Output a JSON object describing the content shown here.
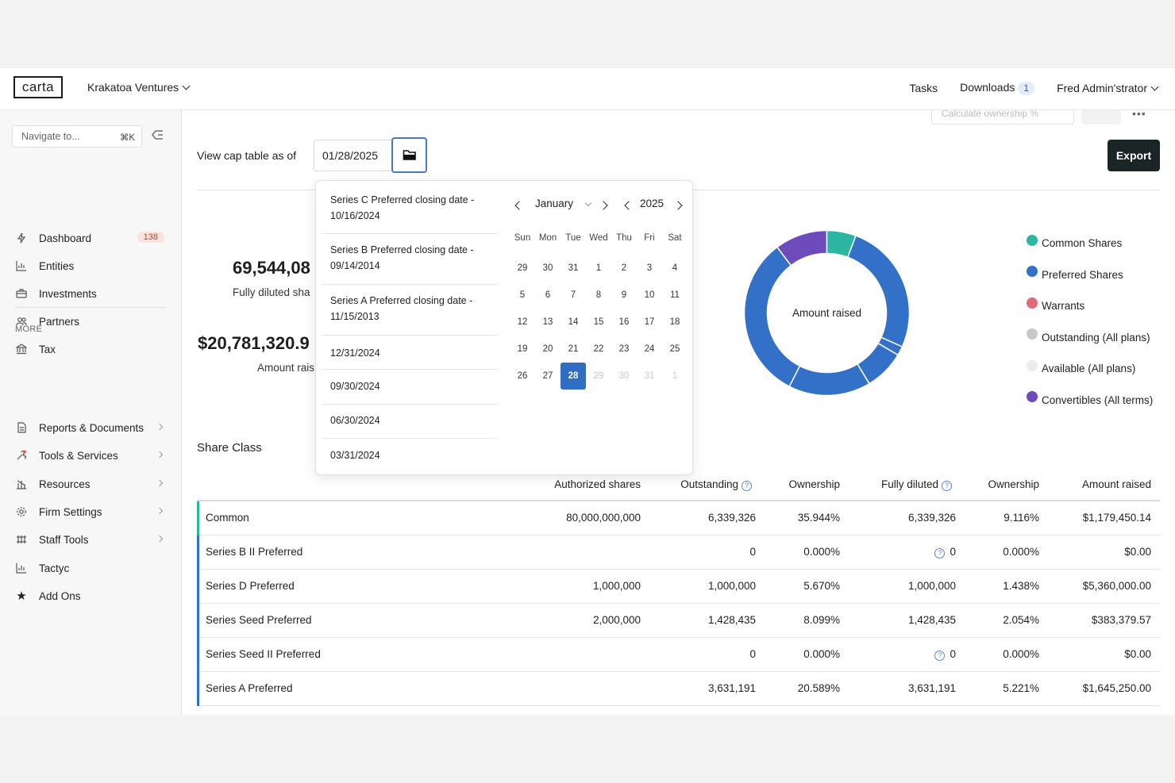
{
  "app": {
    "logo": "carta",
    "org_name": "Krakatoa Ventures",
    "tasks_label": "Tasks",
    "downloads_label": "Downloads",
    "downloads_count": "1",
    "user_name": "Fred Admin'strator"
  },
  "sidebar": {
    "search_placeholder": "Navigate to...",
    "search_shortcut": "⌘K",
    "items": [
      {
        "label": "Dashboard",
        "icon": "bolt-icon",
        "badge": "138"
      },
      {
        "label": "Entities",
        "icon": "chart-icon"
      },
      {
        "label": "Investments",
        "icon": "briefcase-icon"
      },
      {
        "label": "Partners",
        "icon": "people-icon"
      },
      {
        "label": "Tax",
        "icon": "bank-icon"
      }
    ],
    "more_label": "MORE",
    "more_items": [
      {
        "label": "Reports & Documents",
        "icon": "document-icon"
      },
      {
        "label": "Tools & Services",
        "icon": "tools-icon"
      },
      {
        "label": "Resources",
        "icon": "resources-icon"
      },
      {
        "label": "Firm Settings",
        "icon": "gear-icon"
      },
      {
        "label": "Staff Tools",
        "icon": "staff-icon"
      },
      {
        "label": "Tactyc",
        "icon": "chart-icon"
      },
      {
        "label": "Add Ons",
        "icon": "star-icon"
      }
    ]
  },
  "main": {
    "ghost_button": "Calculate ownership %",
    "view_as_of_label": "View cap table as of",
    "date_value": "01/28/2025",
    "export_label": "Export",
    "stats": {
      "fully_diluted_value": "69,544,08",
      "fully_diluted_label": "Fully diluted sha",
      "amount_raised_value": "$20,781,320.9",
      "amount_raised_label": "Amount rais"
    },
    "donut_center_label": "Amount raised",
    "legend": [
      {
        "label": "Common Shares",
        "color": "#2cb5a0"
      },
      {
        "label": "Preferred Shares",
        "color": "#3370c7"
      },
      {
        "label": "Warrants",
        "color": "#e06a7a"
      },
      {
        "label": "Outstanding (All plans)",
        "color": "#c8c8c8"
      },
      {
        "label": "Available (All plans)",
        "color": "#ececec"
      },
      {
        "label": "Convertibles (All terms)",
        "color": "#6d4bbd"
      }
    ],
    "share_class_title": "Share Class",
    "table": {
      "headers": [
        "Authorized shares",
        "Outstanding",
        "Ownership",
        "Fully diluted",
        "Ownership",
        "Amount raised"
      ],
      "rows": [
        {
          "name": "Common",
          "authorized": "80,000,000,000",
          "outstanding": "6,339,326",
          "ownership": "35.944%",
          "fully_diluted": "6,339,326",
          "fd_ownership": "9.116%",
          "amount": "$1,179,450.14",
          "color": "#2cb5a0",
          "fd_help": false
        },
        {
          "name": "Series B II Preferred",
          "authorized": "",
          "outstanding": "0",
          "ownership": "0.000%",
          "fully_diluted": "0",
          "fd_ownership": "0.000%",
          "amount": "$0.00",
          "color": "#3370c7",
          "fd_help": true
        },
        {
          "name": "Series D Preferred",
          "authorized": "1,000,000",
          "outstanding": "1,000,000",
          "ownership": "5.670%",
          "fully_diluted": "1,000,000",
          "fd_ownership": "1.438%",
          "amount": "$5,360,000.00",
          "color": "#3370c7",
          "fd_help": false
        },
        {
          "name": "Series Seed Preferred",
          "authorized": "2,000,000",
          "outstanding": "1,428,435",
          "ownership": "8.099%",
          "fully_diluted": "1,428,435",
          "fd_ownership": "2.054%",
          "amount": "$383,379.57",
          "color": "#3370c7",
          "fd_help": false
        },
        {
          "name": "Series Seed II Preferred",
          "authorized": "",
          "outstanding": "0",
          "ownership": "0.000%",
          "fully_diluted": "0",
          "fd_ownership": "0.000%",
          "amount": "$0.00",
          "color": "#3370c7",
          "fd_help": true
        },
        {
          "name": "Series A Preferred",
          "authorized": "",
          "outstanding": "3,631,191",
          "ownership": "20.589%",
          "fully_diluted": "3,631,191",
          "fd_ownership": "5.221%",
          "amount": "$1,645,250.00",
          "color": "#3370c7",
          "fd_help": false
        }
      ]
    }
  },
  "datepicker": {
    "presets": [
      "Series C Preferred closing date - 10/16/2024",
      "Series B Preferred closing date - 09/14/2014",
      "Series A Preferred closing date - 11/15/2013",
      "12/31/2024",
      "09/30/2024",
      "06/30/2024",
      "03/31/2024"
    ],
    "month": "January",
    "year": "2025",
    "weekdays": [
      "Sun",
      "Mon",
      "Tue",
      "Wed",
      "Thu",
      "Fri",
      "Sat"
    ],
    "weeks": [
      [
        "29",
        "30",
        "31",
        "1",
        "2",
        "3",
        "4"
      ],
      [
        "5",
        "6",
        "7",
        "8",
        "9",
        "10",
        "11"
      ],
      [
        "12",
        "13",
        "14",
        "15",
        "16",
        "17",
        "18"
      ],
      [
        "19",
        "20",
        "21",
        "22",
        "23",
        "24",
        "25"
      ],
      [
        "26",
        "27",
        "28",
        "29",
        "30",
        "31",
        "1"
      ]
    ],
    "selected_day": "28"
  },
  "donut_chart": {
    "segments": [
      {
        "name": "Common Shares",
        "fraction": 0.057,
        "color": "#2cb5a0"
      },
      {
        "name": "Preferred Shares",
        "fraction": 0.26,
        "color": "#3370c7"
      },
      {
        "name": "Preferred Shares",
        "fraction": 0.018,
        "color": "#3370c7"
      },
      {
        "name": "Preferred Shares",
        "fraction": 0.079,
        "color": "#3370c7"
      },
      {
        "name": "Preferred Shares",
        "fraction": 0.161,
        "color": "#3370c7"
      },
      {
        "name": "Preferred Shares",
        "fraction": 0.322,
        "color": "#3370c7"
      },
      {
        "name": "Convertibles (All terms)",
        "fraction": 0.103,
        "color": "#6d4bbd"
      }
    ]
  }
}
